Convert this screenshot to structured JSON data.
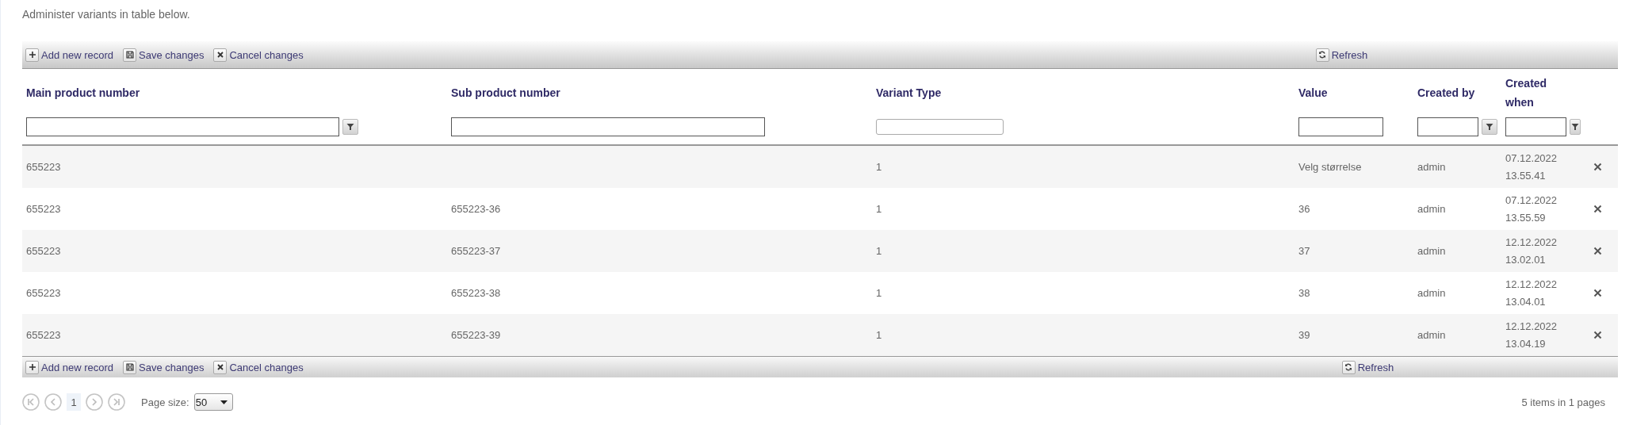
{
  "intro": "Administer variants in table below.",
  "top_toolbar": {
    "buttons": [
      {
        "kind": "add",
        "label": "Add new record"
      },
      {
        "kind": "save",
        "label": "Save changes"
      },
      {
        "kind": "cancel",
        "label": "Cancel changes"
      }
    ],
    "refresh": "Refresh"
  },
  "table": {
    "columns": [
      {
        "label": "Main product number",
        "kind": "text_with_button"
      },
      {
        "label": "Sub product number",
        "kind": "text"
      },
      {
        "label": "Variant Type",
        "kind": "numeric"
      },
      {
        "label": "Value",
        "kind": "text"
      },
      {
        "label": "Created by",
        "kind": "text_with_button"
      },
      {
        "label": "Created when",
        "kind": "text_with_button"
      }
    ],
    "rows": [
      {
        "cells": [
          "655223",
          "",
          "1",
          "Velg størrelse",
          "admin",
          "07.12.2022 13.55.41"
        ]
      },
      {
        "cells": [
          "655223",
          "655223-36",
          "1",
          "36",
          "admin",
          "07.12.2022 13.55.59"
        ]
      },
      {
        "cells": [
          "655223",
          "655223-37",
          "1",
          "37",
          "admin",
          "12.12.2022 13.02.01"
        ]
      },
      {
        "cells": [
          "655223",
          "655223-38",
          "1",
          "38",
          "admin",
          "12.12.2022 13.04.01"
        ]
      },
      {
        "cells": [
          "655223",
          "655223-39",
          "1",
          "39",
          "admin",
          "12.12.2022 13.04.19"
        ]
      }
    ]
  },
  "bottom_toolbar": {
    "buttons": [
      {
        "kind": "add",
        "label": "Add new record"
      },
      {
        "kind": "save",
        "label": "Save changes"
      },
      {
        "kind": "cancel",
        "label": "Cancel changes"
      }
    ],
    "refresh": "Refresh"
  },
  "pager": {
    "current_page": "1",
    "page_size_label": "Page size:",
    "page_size": "50",
    "summary": "5 items in 1 pages"
  }
}
